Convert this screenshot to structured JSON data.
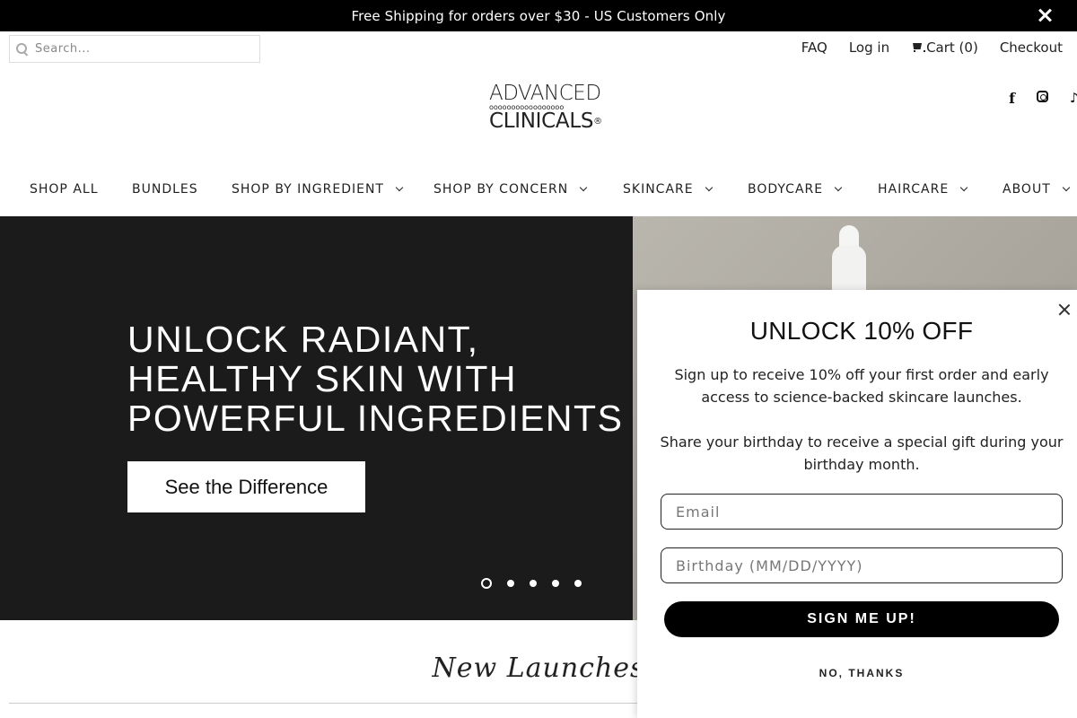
{
  "announcement": {
    "text": "Free Shipping for orders over $30 - US Customers Only",
    "close_icon": "close-icon"
  },
  "search": {
    "placeholder": "Search...",
    "value": ""
  },
  "utility_links": {
    "faq": "FAQ",
    "login": "Log in",
    "cart": "Cart (0)",
    "checkout": "Checkout"
  },
  "logo": {
    "line1": "ADVANCED",
    "dots": "ooooooooooooooooo",
    "line2": "CLINICALS",
    "reg": "®"
  },
  "social": {
    "facebook": "f",
    "tiktok": "♪"
  },
  "nav": {
    "items": [
      {
        "label": "SHOP ALL",
        "dropdown": false
      },
      {
        "label": "BUNDLES",
        "dropdown": false
      },
      {
        "label": "SHOP BY INGREDIENT",
        "dropdown": true
      },
      {
        "label": "SHOP BY CONCERN",
        "dropdown": true
      },
      {
        "label": "SKINCARE",
        "dropdown": true
      },
      {
        "label": "BODYCARE",
        "dropdown": true
      },
      {
        "label": "HAIRCARE",
        "dropdown": true
      },
      {
        "label": "ABOUT",
        "dropdown": true
      }
    ]
  },
  "hero": {
    "title_lines": [
      "UNLOCK RADIANT,",
      "HEALTHY SKIN WITH",
      "POWERFUL INGREDIENTS"
    ],
    "button": "See the Difference",
    "slides": 5,
    "active_slide": 1,
    "background_color": "#1b1b1b"
  },
  "section": {
    "title": "New Launches"
  },
  "popup": {
    "title": "UNLOCK 10% OFF",
    "text1": "Sign up to receive 10% off your first order and early access to science-backed skincare launches.",
    "text2": "Share your birthday to receive a special gift during your birthday month.",
    "email_placeholder": "Email",
    "birthday_placeholder": "Birthday (MM/DD/YYYY)",
    "submit": "SIGN ME UP!",
    "decline": "NO, THANKS"
  }
}
